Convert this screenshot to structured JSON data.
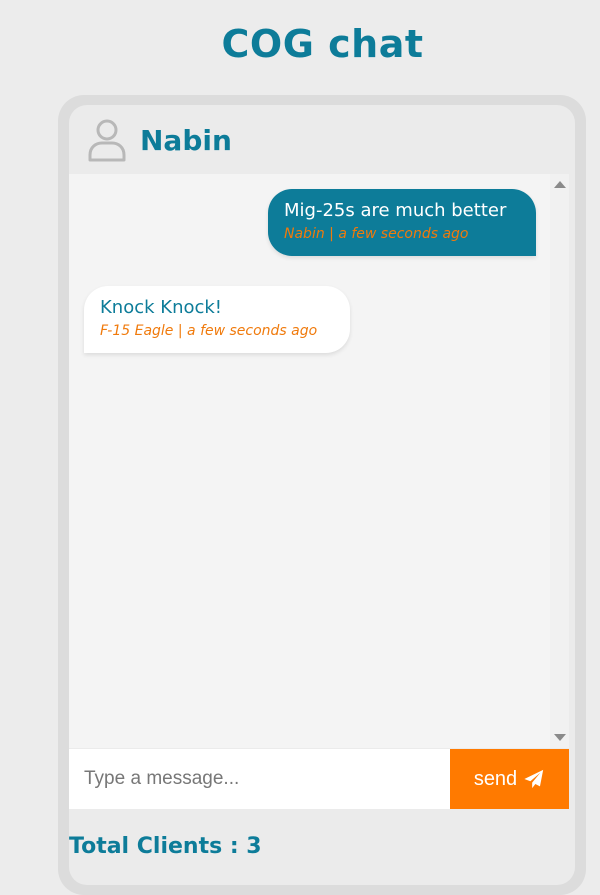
{
  "app": {
    "title": "COG chat"
  },
  "header": {
    "user_icon": "user-icon",
    "user_name": "Nabin"
  },
  "messages": [
    {
      "direction": "sent",
      "text": "Mig-25s are much better",
      "meta": "Nabin | a few seconds ago"
    },
    {
      "direction": "received",
      "text": "Knock Knock!",
      "meta": "F-15 Eagle | a few seconds ago"
    }
  ],
  "composer": {
    "placeholder": "Type a message...",
    "value": "",
    "send_label": "send",
    "send_icon": "paper-plane-icon"
  },
  "footer": {
    "total_clients": "Total Clients : 3"
  },
  "colors": {
    "primary": "#0d7c99",
    "accent": "#ff7a00",
    "meta_text": "#f07a0c",
    "background": "#ececec"
  }
}
